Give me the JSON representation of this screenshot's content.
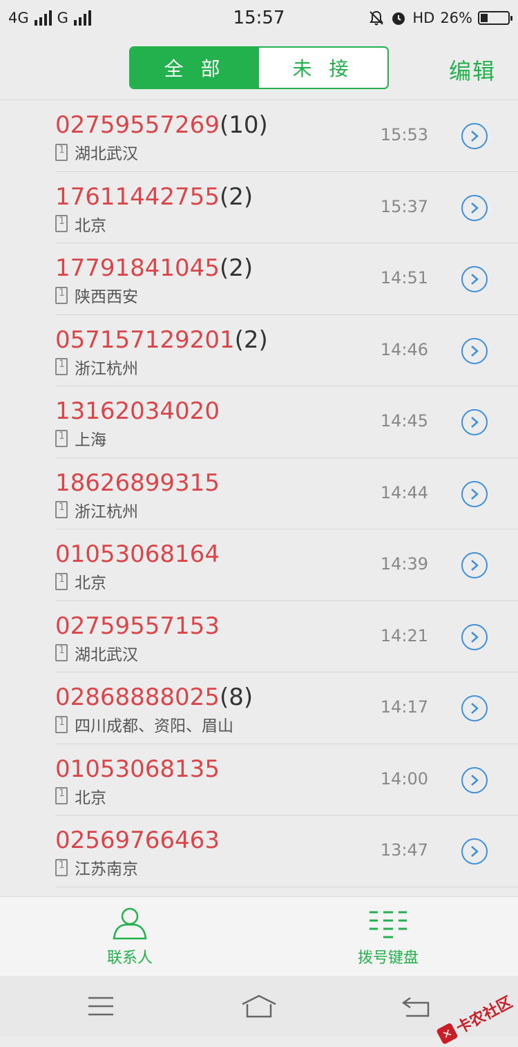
{
  "status_bar": {
    "network1": "4G",
    "network2": "G",
    "time": "15:57",
    "hd": "HD",
    "battery": "26%"
  },
  "header": {
    "tab_all": "全 部",
    "tab_missed": "未 接",
    "edit": "编辑"
  },
  "calls": [
    {
      "number": "02759557269",
      "count": "(10)",
      "location": "湖北武汉",
      "time": "15:53"
    },
    {
      "number": "17611442755",
      "count": "(2)",
      "location": "北京",
      "time": "15:37"
    },
    {
      "number": "17791841045",
      "count": "(2)",
      "location": "陕西西安",
      "time": "14:51"
    },
    {
      "number": "057157129201",
      "count": "(2)",
      "location": "浙江杭州",
      "time": "14:46"
    },
    {
      "number": "13162034020",
      "count": "",
      "location": "上海",
      "time": "14:45"
    },
    {
      "number": "18626899315",
      "count": "",
      "location": "浙江杭州",
      "time": "14:44"
    },
    {
      "number": "01053068164",
      "count": "",
      "location": "北京",
      "time": "14:39"
    },
    {
      "number": "02759557153",
      "count": "",
      "location": "湖北武汉",
      "time": "14:21"
    },
    {
      "number": "02868888025",
      "count": "(8)",
      "location": "四川成都、资阳、眉山",
      "time": "14:17"
    },
    {
      "number": "01053068135",
      "count": "",
      "location": "北京",
      "time": "14:00"
    },
    {
      "number": "02569766463",
      "count": "",
      "location": "江苏南京",
      "time": "13:47"
    }
  ],
  "tabbar": {
    "contacts": "联系人",
    "dialpad": "拨号键盘"
  },
  "watermark": {
    "text": "卡农社区"
  },
  "colors": {
    "accent": "#22b14c",
    "number": "#d9464a",
    "detail": "#3d8fd9"
  },
  "icons": {
    "contacts": "person-icon",
    "dialpad": "dialpad-icon",
    "detail": "chevron-circle-icon"
  }
}
